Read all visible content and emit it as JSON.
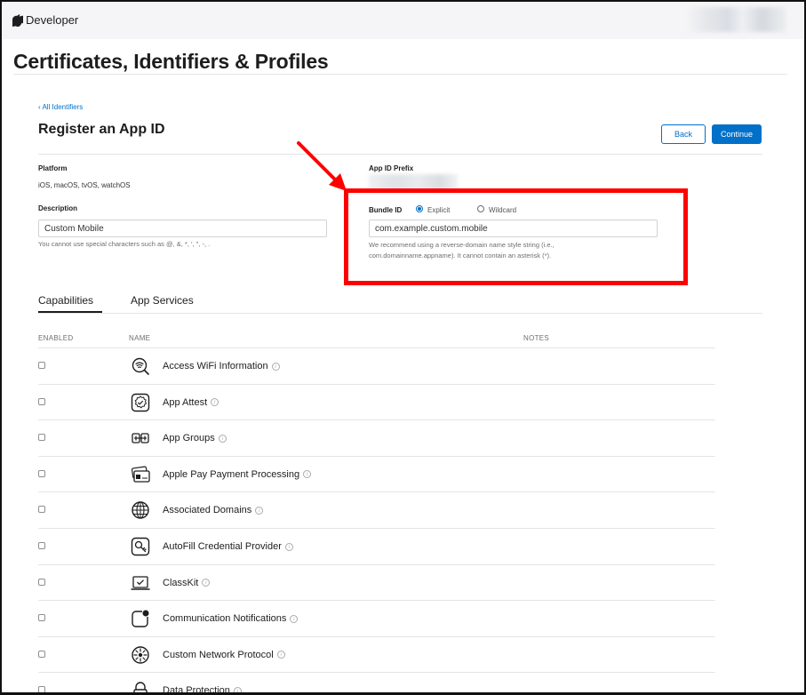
{
  "header": {
    "brand": "Developer"
  },
  "page": {
    "title": "Certificates, Identifiers & Profiles",
    "back_link": "‹ All Identifiers",
    "section_title": "Register an App ID",
    "back_button": "Back",
    "continue_button": "Continue"
  },
  "form": {
    "platform_label": "Platform",
    "platform_value": "iOS, macOS, tvOS, watchOS",
    "description_label": "Description",
    "description_value": "Custom Mobile",
    "description_hint": "You cannot use special characters such as @, &, *, ', \", -, .",
    "prefix_label": "App ID Prefix",
    "bundle_label": "Bundle ID",
    "bundle_options": [
      "Explicit",
      "Wildcard"
    ],
    "bundle_selected": "Explicit",
    "bundle_value": "com.example.custom.mobile",
    "bundle_hint_line1": "We recommend using a reverse-domain name style string (i.e.,",
    "bundle_hint_line2": "com.domainname.appname). It cannot contain an asterisk (*)."
  },
  "tabs": [
    "Capabilities",
    "App Services"
  ],
  "table": {
    "columns": [
      "ENABLED",
      "NAME",
      "NOTES"
    ],
    "rows": [
      {
        "name": "Access WiFi Information",
        "icon": "wifi-info-icon",
        "enabled": false
      },
      {
        "name": "App Attest",
        "icon": "app-attest-icon",
        "enabled": false
      },
      {
        "name": "App Groups",
        "icon": "app-groups-icon",
        "enabled": false
      },
      {
        "name": "Apple Pay Payment Processing",
        "icon": "apple-pay-icon",
        "enabled": false
      },
      {
        "name": "Associated Domains",
        "icon": "globe-icon",
        "enabled": false
      },
      {
        "name": "AutoFill Credential Provider",
        "icon": "key-icon",
        "enabled": false
      },
      {
        "name": "ClassKit",
        "icon": "classkit-icon",
        "enabled": false
      },
      {
        "name": "Communication Notifications",
        "icon": "notification-icon",
        "enabled": false
      },
      {
        "name": "Custom Network Protocol",
        "icon": "network-protocol-icon",
        "enabled": false
      },
      {
        "name": "Data Protection",
        "icon": "lock-icon",
        "enabled": false
      }
    ]
  },
  "colors": {
    "accent": "#0070c9",
    "highlight": "#ff0000"
  }
}
